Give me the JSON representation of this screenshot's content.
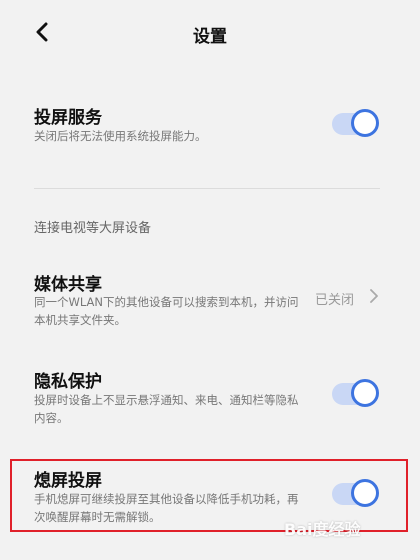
{
  "header": {
    "title": "设置",
    "back_icon": "back-chevron-icon"
  },
  "cast_service": {
    "title": "投屏服务",
    "desc": "关闭后将无法使用系统投屏能力。",
    "enabled": true
  },
  "section": {
    "label": "连接电视等大屏设备"
  },
  "media_share": {
    "title": "媒体共享",
    "desc": "同一个WLAN下的其他设备可以搜索到本机，并访问本机共享文件夹。",
    "value": "已关闭"
  },
  "privacy": {
    "title": "隐私保护",
    "desc": "投屏时设备上不显示悬浮通知、来电、通知栏等隐私内容。",
    "enabled": true
  },
  "screen_off_cast": {
    "title": "熄屏投屏",
    "desc": "手机熄屏可继续投屏至其他设备以降低手机功耗，再次唤醒屏幕时无需解锁。",
    "enabled": true
  },
  "watermark": {
    "text": "Bai度经验"
  },
  "colors": {
    "accent": "#3d74e0",
    "highlight_border": "#e0202a"
  }
}
